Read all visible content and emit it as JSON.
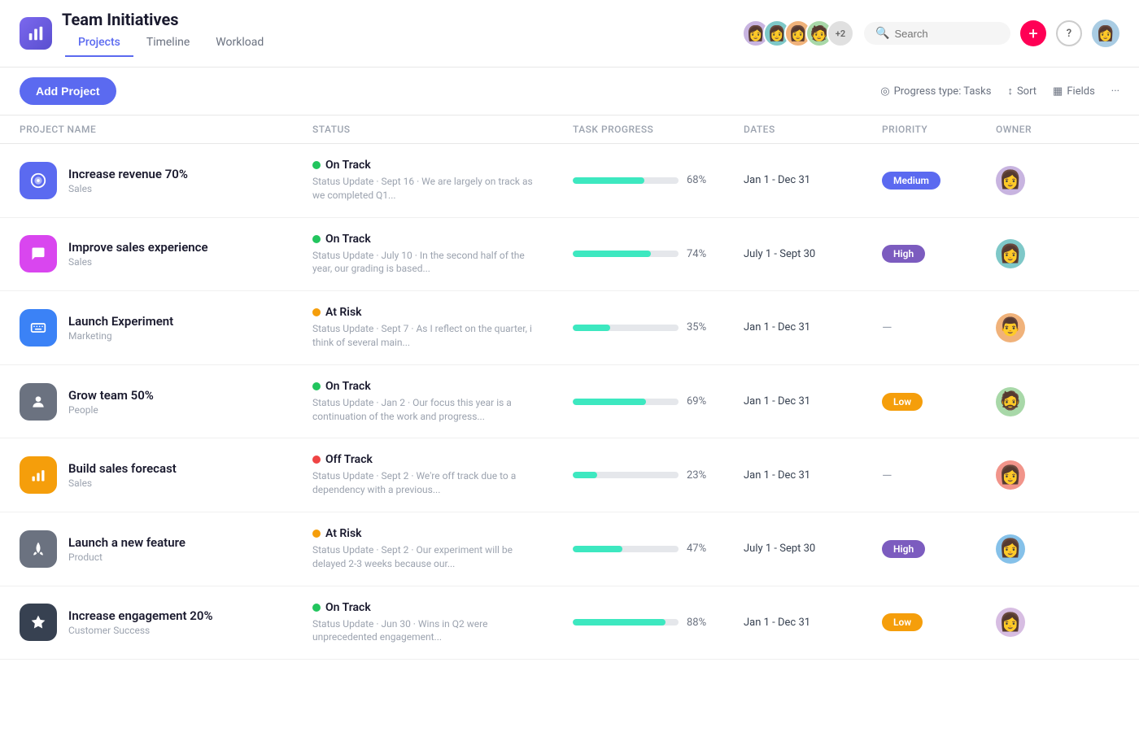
{
  "header": {
    "logo_icon": "📊",
    "app_title": "Team Initiatives",
    "nav_tabs": [
      {
        "label": "Projects",
        "active": true
      },
      {
        "label": "Timeline",
        "active": false
      },
      {
        "label": "Workload",
        "active": false
      }
    ],
    "search_placeholder": "Search",
    "add_button_label": "+",
    "help_label": "?"
  },
  "toolbar": {
    "add_project_label": "Add Project",
    "progress_type_label": "Progress type: Tasks",
    "sort_label": "Sort",
    "fields_label": "Fields"
  },
  "table": {
    "columns": [
      {
        "label": "Project name"
      },
      {
        "label": "Status"
      },
      {
        "label": "Task progress"
      },
      {
        "label": "Dates"
      },
      {
        "label": "Priority"
      },
      {
        "label": "Owner"
      }
    ],
    "rows": [
      {
        "name": "Increase revenue 70%",
        "team": "Sales",
        "icon_bg": "#5b6af0",
        "icon": "🎯",
        "status": "On Track",
        "status_color": "#22c55e",
        "status_update": "Status Update · Sept 16 · We are largely on track as we completed Q1...",
        "progress": 68,
        "dates": "Jan 1 - Dec 31",
        "priority": "Medium",
        "priority_class": "priority-medium",
        "owner_class": "av1"
      },
      {
        "name": "Improve sales experience",
        "team": "Sales",
        "icon_bg": "#d946ef",
        "icon": "💬",
        "status": "On Track",
        "status_color": "#22c55e",
        "status_update": "Status Update · July 10 · In the second half of the year, our grading is based...",
        "progress": 74,
        "dates": "July 1 - Sept 30",
        "priority": "High",
        "priority_class": "priority-high",
        "owner_class": "av2"
      },
      {
        "name": "Launch Experiment",
        "team": "Marketing",
        "icon_bg": "#3b82f6",
        "icon": "⌨",
        "status": "At Risk",
        "status_color": "#f59e0b",
        "status_update": "Status Update · Sept 7 · As I reflect on the quarter, i think of several main...",
        "progress": 35,
        "dates": "Jan 1 - Dec 31",
        "priority": "—",
        "priority_class": "priority-none",
        "owner_class": "av3"
      },
      {
        "name": "Grow team 50%",
        "team": "People",
        "icon_bg": "#6b7280",
        "icon": "👤",
        "status": "On Track",
        "status_color": "#22c55e",
        "status_update": "Status Update · Jan 2 · Our focus this year is a continuation of the work and progress...",
        "progress": 69,
        "dates": "Jan 1 - Dec 31",
        "priority": "Low",
        "priority_class": "priority-low",
        "owner_class": "av4"
      },
      {
        "name": "Build sales forecast",
        "team": "Sales",
        "icon_bg": "#f59e0b",
        "icon": "📊",
        "status": "Off Track",
        "status_color": "#ef4444",
        "status_update": "Status Update · Sept 2 · We're off track due to a dependency with a previous...",
        "progress": 23,
        "dates": "Jan 1 - Dec 31",
        "priority": "—",
        "priority_class": "priority-none",
        "owner_class": "av5"
      },
      {
        "name": "Launch a new feature",
        "team": "Product",
        "icon_bg": "#6b7280",
        "icon": "🚀",
        "status": "At Risk",
        "status_color": "#f59e0b",
        "status_update": "Status Update · Sept 2 · Our experiment will be delayed 2-3 weeks because our...",
        "progress": 47,
        "dates": "July 1 - Sept 30",
        "priority": "High",
        "priority_class": "priority-high",
        "owner_class": "av6"
      },
      {
        "name": "Increase engagement 20%",
        "team": "Customer Success",
        "icon_bg": "#374151",
        "icon": "⭐",
        "status": "On Track",
        "status_color": "#22c55e",
        "status_update": "Status Update · Jun 30 · Wins in Q2 were unprecedented engagement...",
        "progress": 88,
        "dates": "Jan 1 - Dec 31",
        "priority": "Low",
        "priority_class": "priority-low",
        "owner_class": "av7"
      }
    ]
  }
}
